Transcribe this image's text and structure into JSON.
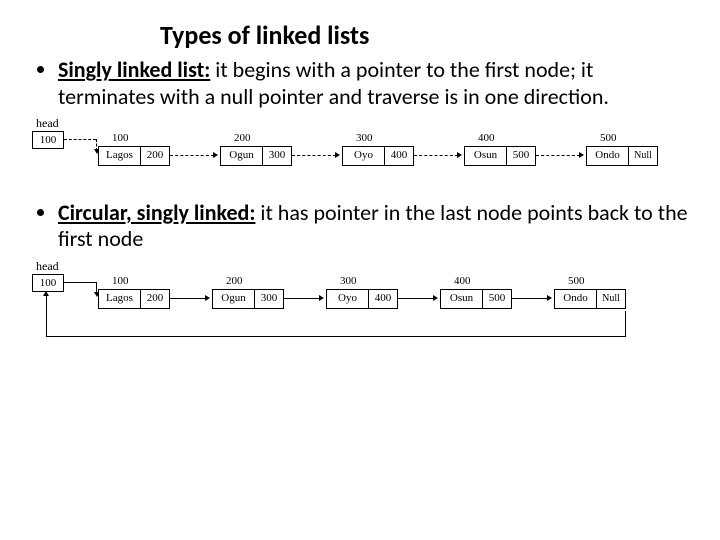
{
  "title": "Types of linked lists",
  "bullets": {
    "b1_term": "Singly linked list:",
    "b1_text": " it begins with a pointer to the first node; it terminates with a null pointer and traverse is in one direction.",
    "b2_term": "Circular, singly linked:",
    "b2_text": " it has pointer in the last node points back to the first node"
  },
  "d1": {
    "head_label": "head",
    "head_value": "100",
    "nodes": [
      {
        "addr": "100",
        "data": "Lagos",
        "ptr": "200"
      },
      {
        "addr": "200",
        "data": "Ogun",
        "ptr": "300"
      },
      {
        "addr": "300",
        "data": "Oyo",
        "ptr": "400"
      },
      {
        "addr": "400",
        "data": "Osun",
        "ptr": "500"
      },
      {
        "addr": "500",
        "data": "Ondo",
        "ptr": "Null"
      }
    ]
  },
  "d2": {
    "head_label": "head",
    "head_value": "100",
    "nodes": [
      {
        "addr": "100",
        "data": "Lagos",
        "ptr": "200"
      },
      {
        "addr": "200",
        "data": "Ogun",
        "ptr": "300"
      },
      {
        "addr": "300",
        "data": "Oyo",
        "ptr": "400"
      },
      {
        "addr": "400",
        "data": "Osun",
        "ptr": "500"
      },
      {
        "addr": "500",
        "data": "Ondo",
        "ptr": "Null"
      }
    ]
  }
}
